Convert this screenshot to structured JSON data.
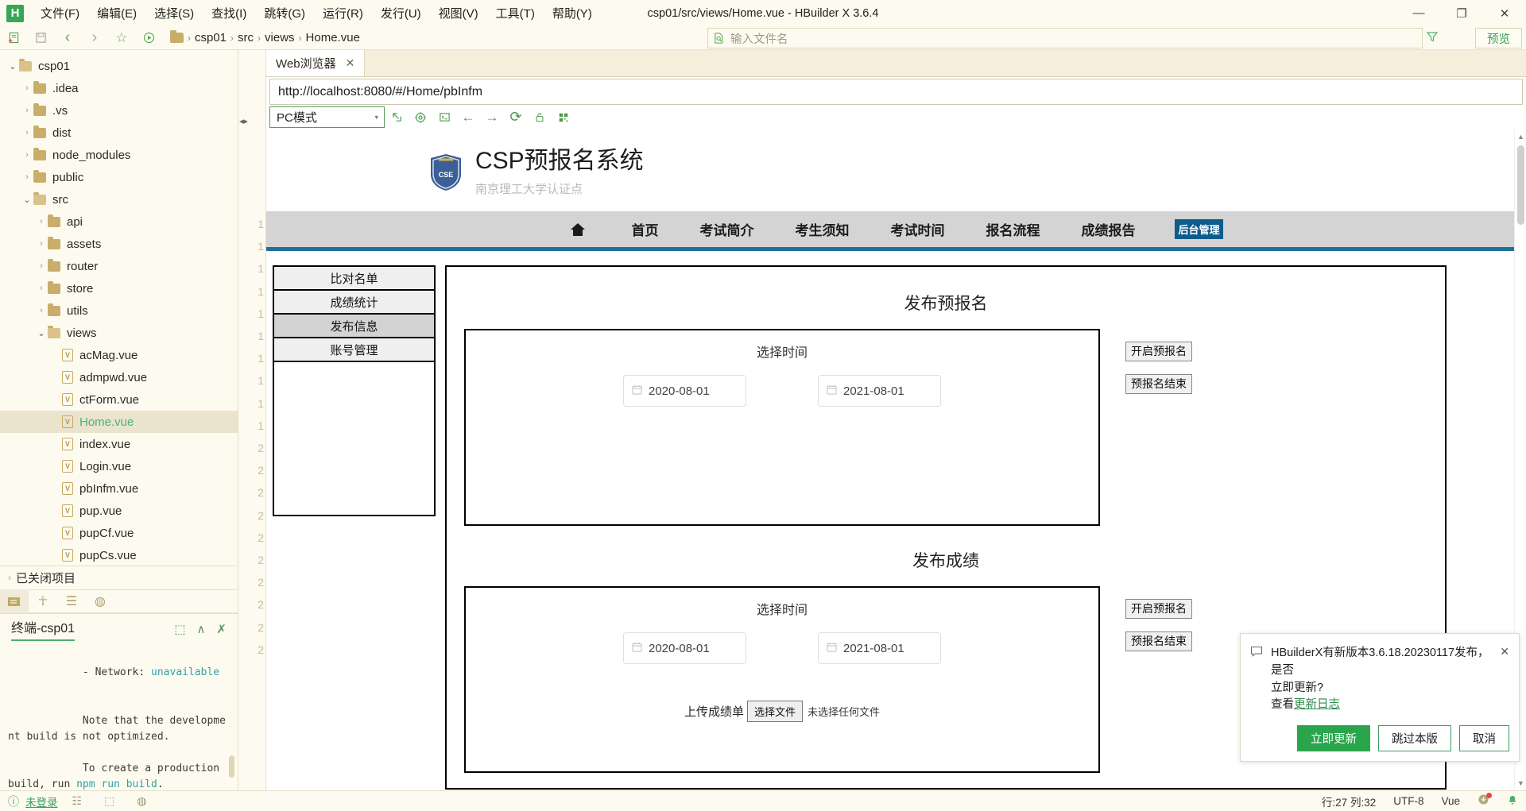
{
  "window": {
    "title": "csp01/src/views/Home.vue - HBuilder X 3.6.4",
    "app_logo": "H",
    "minimize": "—",
    "maximize": "❐",
    "close": "✕"
  },
  "menubar": {
    "items": [
      {
        "label": "文件(F)"
      },
      {
        "label": "编辑(E)"
      },
      {
        "label": "选择(S)"
      },
      {
        "label": "查找(I)"
      },
      {
        "label": "跳转(G)"
      },
      {
        "label": "运行(R)"
      },
      {
        "label": "发行(U)"
      },
      {
        "label": "视图(V)"
      },
      {
        "label": "工具(T)"
      },
      {
        "label": "帮助(Y)"
      }
    ]
  },
  "toolbar": {
    "icons": [
      {
        "name": "new-file-icon",
        "glyph": "▤"
      },
      {
        "name": "save-icon",
        "glyph": "ὋE"
      },
      {
        "name": "back-icon",
        "glyph": "‹"
      },
      {
        "name": "forward-icon",
        "glyph": "›"
      },
      {
        "name": "favorite-icon",
        "glyph": "☆"
      },
      {
        "name": "run-icon",
        "glyph": "▷"
      }
    ],
    "breadcrumb": [
      "csp01",
      "src",
      "views",
      "Home.vue"
    ],
    "breadcrumb_sep": "›",
    "filename_placeholder": "输入文件名",
    "filename_value": "",
    "filter_icon": "▽",
    "preview_label": "预览"
  },
  "file_tree": {
    "items": [
      {
        "label": "csp01",
        "type": "folder-open",
        "indent": 0,
        "arrow": "⌄",
        "selected": false
      },
      {
        "label": ".idea",
        "type": "folder",
        "indent": 1,
        "arrow": "›",
        "selected": false
      },
      {
        "label": ".vs",
        "type": "folder",
        "indent": 1,
        "arrow": "›",
        "selected": false
      },
      {
        "label": "dist",
        "type": "folder",
        "indent": 1,
        "arrow": "›",
        "selected": false
      },
      {
        "label": "node_modules",
        "type": "folder",
        "indent": 1,
        "arrow": "›",
        "selected": false
      },
      {
        "label": "public",
        "type": "folder",
        "indent": 1,
        "arrow": "›",
        "selected": false
      },
      {
        "label": "src",
        "type": "folder-open",
        "indent": 1,
        "arrow": "⌄",
        "selected": false
      },
      {
        "label": "api",
        "type": "folder",
        "indent": 2,
        "arrow": "›",
        "selected": false
      },
      {
        "label": "assets",
        "type": "folder",
        "indent": 2,
        "arrow": "›",
        "selected": false
      },
      {
        "label": "router",
        "type": "folder",
        "indent": 2,
        "arrow": "›",
        "selected": false
      },
      {
        "label": "store",
        "type": "folder",
        "indent": 2,
        "arrow": "›",
        "selected": false
      },
      {
        "label": "utils",
        "type": "folder",
        "indent": 2,
        "arrow": "›",
        "selected": false
      },
      {
        "label": "views",
        "type": "folder-open",
        "indent": 2,
        "arrow": "⌄",
        "selected": false
      },
      {
        "label": "acMag.vue",
        "type": "vue",
        "indent": 3,
        "arrow": "",
        "selected": false
      },
      {
        "label": "admpwd.vue",
        "type": "vue",
        "indent": 3,
        "arrow": "",
        "selected": false
      },
      {
        "label": "ctForm.vue",
        "type": "vue",
        "indent": 3,
        "arrow": "",
        "selected": false
      },
      {
        "label": "Home.vue",
        "type": "vue",
        "indent": 3,
        "arrow": "",
        "selected": true
      },
      {
        "label": "index.vue",
        "type": "vue",
        "indent": 3,
        "arrow": "",
        "selected": false
      },
      {
        "label": "Login.vue",
        "type": "vue",
        "indent": 3,
        "arrow": "",
        "selected": false
      },
      {
        "label": "pbInfm.vue",
        "type": "vue",
        "indent": 3,
        "arrow": "",
        "selected": false
      },
      {
        "label": "pup.vue",
        "type": "vue",
        "indent": 3,
        "arrow": "",
        "selected": false
      },
      {
        "label": "pupCf.vue",
        "type": "vue",
        "indent": 3,
        "arrow": "",
        "selected": false
      },
      {
        "label": "pupCs.vue",
        "type": "vue",
        "indent": 3,
        "arrow": "",
        "selected": false
      }
    ],
    "closed_projects": "已关闭项目",
    "closed_projects_arrow": "›",
    "panel_tabs": [
      {
        "name": "project-manager-tab",
        "glyph": "▤",
        "active": true
      },
      {
        "name": "debug-tab",
        "glyph": "☥",
        "active": false
      },
      {
        "name": "search-results-tab",
        "glyph": "☰",
        "active": false
      },
      {
        "name": "cloud-tab",
        "glyph": "◍",
        "active": false
      }
    ]
  },
  "terminal": {
    "title": "终端-csp01",
    "actions": [
      {
        "name": "new-terminal-icon",
        "glyph": "⬚"
      },
      {
        "name": "collapse-icon",
        "glyph": "∧"
      },
      {
        "name": "close-terminal-icon",
        "glyph": "✗"
      }
    ],
    "lines": [
      {
        "text": "  - Network: ",
        "tail": "unavailable",
        "tail_color": "cy"
      },
      {
        "text": "",
        "tail": "",
        "tail_color": ""
      },
      {
        "text": "  Note that the development build is not optimized.",
        "tail": "",
        "tail_color": ""
      },
      {
        "text": "  To create a production build, run ",
        "tail": "npm run build",
        "tail_color": "cy"
      },
      {
        "text": ".",
        "tail": "",
        "tail_color": ""
      }
    ]
  },
  "editor": {
    "gutter_numbers": [
      "1",
      "1",
      "1",
      "1",
      "1",
      "1",
      "1",
      "1",
      "1",
      "1",
      "2",
      "2",
      "2",
      "2",
      "2",
      "2",
      "2",
      "2",
      "2",
      "2"
    ]
  },
  "webview": {
    "tab_label": "Web浏览器",
    "tab_close": "✕",
    "url": "http://localhost:8080/#/Home/pbInfm",
    "mode_select": "PC模式",
    "mode_caret": "▾",
    "controls": [
      {
        "name": "open-external-icon",
        "glyph": "↗"
      },
      {
        "name": "settings-gear-icon",
        "glyph": "⚙"
      },
      {
        "name": "console-icon",
        "glyph": "⬚"
      },
      {
        "name": "back-icon",
        "glyph": "←"
      },
      {
        "name": "forward-icon",
        "glyph": "→"
      },
      {
        "name": "reload-icon",
        "glyph": "⟳"
      },
      {
        "name": "lock-icon",
        "glyph": "⚿"
      },
      {
        "name": "qrcode-icon",
        "glyph": "∷"
      }
    ]
  },
  "site": {
    "title": "CSP预报名系统",
    "subtitle": "南京理工大学认证点",
    "crest_text": "CSE",
    "nav": {
      "home_icon": "⌂",
      "links": [
        {
          "label": "首页",
          "active": false
        },
        {
          "label": "考试简介",
          "active": false
        },
        {
          "label": "考生须知",
          "active": false
        },
        {
          "label": "考试时间",
          "active": false
        },
        {
          "label": "报名流程",
          "active": false
        },
        {
          "label": "成绩报告",
          "active": false
        },
        {
          "label": "后台管理",
          "active": true
        }
      ]
    },
    "admin_menu": [
      {
        "label": "比对名单",
        "active": false
      },
      {
        "label": "成绩统计",
        "active": false
      },
      {
        "label": "发布信息",
        "active": true
      },
      {
        "label": "账号管理",
        "active": false
      }
    ],
    "sections": [
      {
        "title": "发布预报名",
        "caption": "选择时间",
        "date_start": "2020-08-01",
        "date_end": "2021-08-01",
        "calendar_icon": "Ὄ5",
        "buttons": [
          {
            "label": "开启预报名"
          },
          {
            "label": "预报名结束"
          }
        ],
        "has_upload": false,
        "upload_label": "",
        "upload_button": "",
        "upload_status": ""
      },
      {
        "title": "发布成绩",
        "caption": "选择时间",
        "date_start": "2020-08-01",
        "date_end": "2021-08-01",
        "calendar_icon": "Ὄ5",
        "buttons": [
          {
            "label": "开启预报名"
          },
          {
            "label": "预报名结束"
          }
        ],
        "has_upload": true,
        "upload_label": "上传成绩单",
        "upload_button": "选择文件",
        "upload_status": "未选择任何文件"
      }
    ]
  },
  "toast": {
    "icon": "὞8",
    "message_line1": "HBuilderX有新版本3.6.18.20230117发布，是否",
    "message_line2": "立即更新?",
    "link_prefix": "查看",
    "link_label": "更新日志",
    "close": "✕",
    "buttons": [
      {
        "label": "立即更新",
        "primary": true
      },
      {
        "label": "跳过本版",
        "primary": false
      },
      {
        "label": "取消",
        "primary": false
      }
    ]
  },
  "statusbar": {
    "login_icon": "ⓘ",
    "login_label": "未登录",
    "left_icons": [
      {
        "name": "outline-icon",
        "glyph": "☷"
      },
      {
        "name": "terminal-icon",
        "glyph": "⬚"
      },
      {
        "name": "cloud-icon",
        "glyph": "◍"
      }
    ],
    "line_col": "行:27  列:32",
    "encoding": "UTF-8",
    "language": "Vue",
    "download_icon": "⬇",
    "bell_icon": "ὑ4"
  }
}
